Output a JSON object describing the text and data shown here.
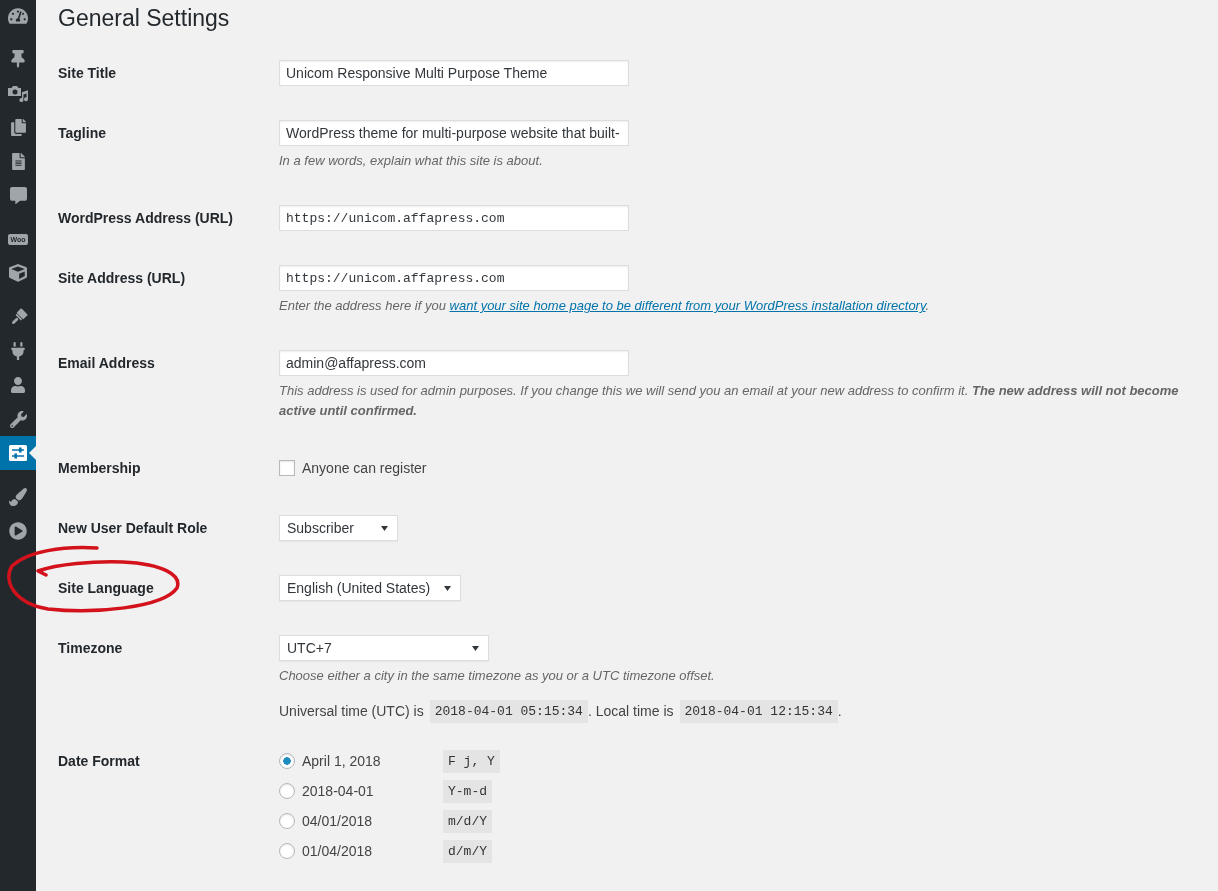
{
  "page": {
    "title": "General Settings"
  },
  "sidebar": {
    "groups": [
      {
        "items": [
          {
            "selected": false
          }
        ]
      },
      {
        "items": [
          {
            "selected": false
          },
          {
            "selected": false
          },
          {
            "selected": false
          },
          {
            "selected": false
          },
          {
            "selected": false
          }
        ]
      },
      {
        "items": [
          {
            "selected": false,
            "logo_text": "Woo"
          },
          {
            "selected": false
          }
        ]
      },
      {
        "items": [
          {
            "selected": false
          },
          {
            "selected": false
          },
          {
            "selected": false
          },
          {
            "selected": false
          },
          {
            "selected": true
          }
        ]
      },
      {
        "items": [
          {
            "selected": false
          },
          {
            "selected": false
          }
        ]
      }
    ]
  },
  "settings": [
    {
      "kind": "text",
      "label": "Site Title",
      "value": "Unicom Responsive Multi Purpose Theme"
    },
    {
      "kind": "text",
      "label": "Tagline",
      "value": "WordPress theme for multi-purpose website that built-",
      "description": "In a few words, explain what this site is about."
    },
    {
      "kind": "url",
      "label": "WordPress Address (URL)",
      "value": "https://unicom.affapress.com"
    },
    {
      "kind": "url",
      "label": "Site Address (URL)",
      "value": "https://unicom.affapress.com",
      "description": "Enter the address here if you",
      "link": "want your site home page to be different from your WordPress installation directory",
      "description_end": "."
    },
    {
      "kind": "text",
      "label": "Email Address",
      "value": "admin@affapress.com",
      "description": "This address is used for admin purposes. If you change this we will send you an email at your new address to confirm it. **The new address will not become active until confirmed.**"
    },
    {
      "kind": "checkbox",
      "label": "Membership",
      "option": "Anyone can register",
      "checked": false
    },
    {
      "kind": "select",
      "label": "New User Default Role",
      "value": "Subscriber"
    },
    {
      "kind": "select",
      "label": "Site Language",
      "value": "English (United States)",
      "circled": true
    },
    {
      "kind": "timezone",
      "label": "Timezone",
      "value": "UTC+7",
      "description": "Choose either a city in the same timezone as you or a UTC timezone offset.",
      "time_line": [
        {
          "kind": "text",
          "text": "Universal time (UTC) is"
        },
        {
          "kind": "code",
          "text": "2018-04-01 05:15:34"
        },
        {
          "kind": "text",
          "text": ". Local time is"
        },
        {
          "kind": "code",
          "text": "2018-04-01 12:15:34"
        },
        {
          "kind": "text",
          "text": "."
        }
      ]
    },
    {
      "kind": "radio_group",
      "label": "Date Format",
      "options": [
        {
          "label": "April 1, 2018",
          "format": "F j, Y",
          "selected": true
        },
        {
          "label": "2018-04-01",
          "format": "Y-m-d",
          "selected": false
        },
        {
          "label": "04/01/2018",
          "format": "m/d/Y",
          "selected": false
        },
        {
          "label": "01/04/2018",
          "format": "d/m/Y",
          "selected": false
        }
      ]
    }
  ]
}
